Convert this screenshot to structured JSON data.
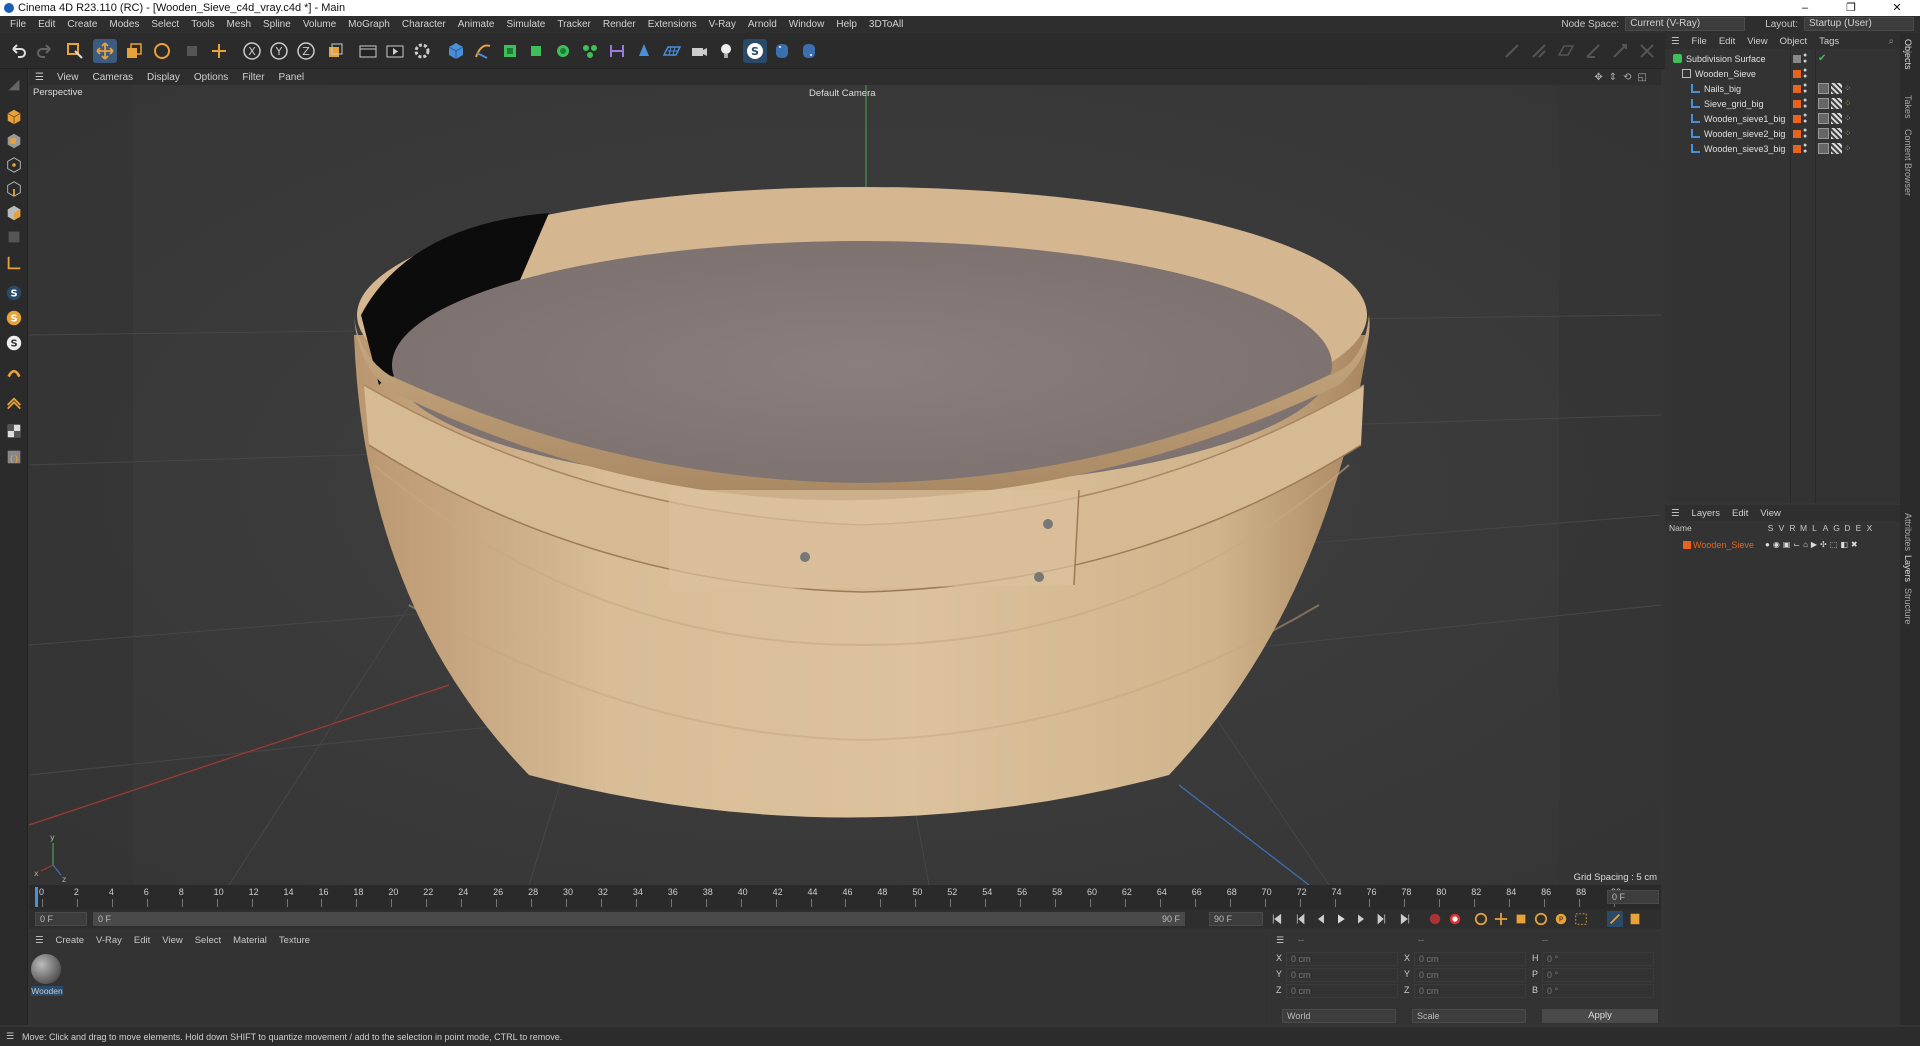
{
  "window": {
    "title": "Cinema 4D R23.110 (RC) - [Wooden_Sieve_c4d_vray.c4d *] - Main",
    "min": "–",
    "max": "❐",
    "close": "✕"
  },
  "menu": [
    "File",
    "Edit",
    "Create",
    "Modes",
    "Select",
    "Tools",
    "Mesh",
    "Spline",
    "Volume",
    "MoGraph",
    "Character",
    "Animate",
    "Simulate",
    "Tracker",
    "Render",
    "Extensions",
    "V-Ray",
    "Arnold",
    "Window",
    "Help",
    "3DToAll"
  ],
  "node_space": {
    "label": "Node Space:",
    "value": "Current (V-Ray)"
  },
  "layout": {
    "label": "Layout:",
    "value": "Startup (User)"
  },
  "viewport": {
    "menu": [
      "View",
      "Cameras",
      "Display",
      "Options",
      "Filter",
      "Panel"
    ],
    "name": "Perspective",
    "camera": "Default Camera",
    "grid_spacing": "Grid Spacing : 5 cm"
  },
  "timeline": {
    "ticks": [
      "0",
      "2",
      "4",
      "6",
      "8",
      "10",
      "12",
      "14",
      "16",
      "18",
      "20",
      "22",
      "24",
      "26",
      "28",
      "30",
      "32",
      "34",
      "36",
      "38",
      "40",
      "42",
      "44",
      "46",
      "48",
      "50",
      "52",
      "54",
      "56",
      "58",
      "60",
      "62",
      "64",
      "66",
      "68",
      "70",
      "72",
      "74",
      "76",
      "78",
      "80",
      "82",
      "84",
      "86",
      "88",
      "90"
    ],
    "current_frame": "0 F"
  },
  "frames": {
    "start": "0 F",
    "preview_start": "0 F",
    "preview_end": "90 F",
    "end": "90 F"
  },
  "materials": {
    "menu": [
      "Create",
      "V-Ray",
      "Edit",
      "View",
      "Select",
      "Material",
      "Texture"
    ],
    "items": [
      {
        "label": "Wooden"
      }
    ]
  },
  "coords": {
    "rows": [
      {
        "a": "X",
        "av": "0 cm",
        "b": "X",
        "bv": "0 cm",
        "c": "H",
        "cv": "0 °"
      },
      {
        "a": "Y",
        "av": "0 cm",
        "b": "Y",
        "bv": "0 cm",
        "c": "P",
        "cv": "0 °"
      },
      {
        "a": "Z",
        "av": "0 cm",
        "b": "Z",
        "bv": "0 cm",
        "c": "B",
        "cv": "0 °"
      }
    ],
    "mode": "World",
    "transform": "Scale",
    "apply": "Apply",
    "hdr1": "--",
    "hdr2": "--",
    "hdr3": "--"
  },
  "objects": {
    "menu": [
      "File",
      "Edit",
      "View",
      "Object",
      "Tags"
    ],
    "items": [
      {
        "name": "Subdivision Surface",
        "indent": 0
      },
      {
        "name": "Wooden_Sieve",
        "indent": 1
      },
      {
        "name": "Nails_big",
        "indent": 2
      },
      {
        "name": "Sieve_grid_big",
        "indent": 2
      },
      {
        "name": "Wooden_sieve1_big",
        "indent": 2
      },
      {
        "name": "Wooden_sieve2_big",
        "indent": 2
      },
      {
        "name": "Wooden_sieve3_big",
        "indent": 2
      }
    ]
  },
  "layers": {
    "menu": [
      "Layers",
      "Edit",
      "View"
    ],
    "col_name": "Name",
    "flags": [
      "S",
      "V",
      "R",
      "M",
      "L",
      "A",
      "G",
      "D",
      "E",
      "X"
    ],
    "items": [
      {
        "name": "Wooden_Sieve"
      }
    ]
  },
  "right_tabs": [
    "Objects",
    "Takes",
    "Content Browser",
    "Attributes",
    "Layers",
    "Structure"
  ],
  "status": "Move: Click and drag to move elements. Hold down SHIFT to quantize movement / add to the selection in point mode, CTRL to remove.",
  "colors": {
    "accent": "#e8641e",
    "selection": "#e8641e",
    "bg": "#353535"
  }
}
